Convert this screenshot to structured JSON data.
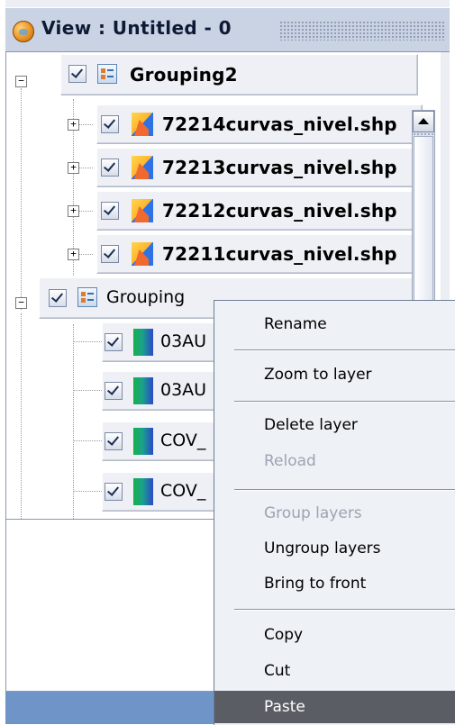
{
  "window": {
    "title": "View : Untitled - 0",
    "title_icon": "view-globe-icon"
  },
  "toc": {
    "groups": [
      {
        "label": "Grouping2",
        "expanded": true,
        "checked": true,
        "icon": "layer-group-icon",
        "layers": [
          {
            "label": "72214curvas_nivel.shp",
            "checked": true,
            "icon": "vector-layer-icon"
          },
          {
            "label": "72213curvas_nivel.shp",
            "checked": true,
            "icon": "vector-layer-icon"
          },
          {
            "label": "72212curvas_nivel.shp",
            "checked": true,
            "icon": "vector-layer-icon"
          },
          {
            "label": "72211curvas_nivel.shp",
            "checked": true,
            "icon": "vector-layer-icon"
          }
        ]
      },
      {
        "label": "Grouping",
        "expanded": true,
        "checked": true,
        "icon": "layer-group-icon",
        "layers": [
          {
            "label": "03AU",
            "checked": true,
            "icon": "raster-layer-icon"
          },
          {
            "label": "03AU",
            "checked": true,
            "icon": "raster-layer-icon"
          },
          {
            "label": "COV_",
            "checked": true,
            "icon": "raster-layer-icon"
          },
          {
            "label": "COV_",
            "checked": true,
            "icon": "raster-layer-icon"
          }
        ]
      }
    ]
  },
  "context_menu": {
    "items": [
      {
        "label": "Rename",
        "enabled": true
      },
      {
        "label": "Zoom to layer",
        "enabled": true
      },
      {
        "label": "Delete layer",
        "enabled": true
      },
      {
        "label": "Reload",
        "enabled": false
      },
      {
        "label": "Group layers",
        "enabled": false
      },
      {
        "label": "Ungroup layers",
        "enabled": true
      },
      {
        "label": "Bring to front",
        "enabled": true
      },
      {
        "label": "Copy",
        "enabled": true
      },
      {
        "label": "Cut",
        "enabled": true
      },
      {
        "label": "Paste",
        "enabled": true,
        "highlighted": true
      }
    ]
  },
  "colors": {
    "titlebar": "#c9d3e4",
    "menu_highlight": "#5a5d63",
    "menu_disabled_text": "#9da4b2",
    "bottom_strip": "#6f95c8"
  }
}
